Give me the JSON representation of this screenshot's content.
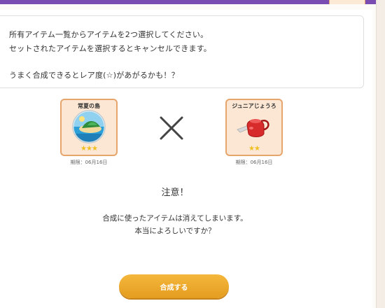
{
  "instructions": {
    "line1": "所有アイテム一覧からアイテムを2つ選択してください。",
    "line2": "セットされたアイテムを選択するとキャンセルできます。",
    "line3": "うまく合成できるとレア度(☆)があがるかも！？"
  },
  "items": [
    {
      "name": "常夏の島",
      "stars": "★★★",
      "rarity_stars": 3,
      "expiry": "期限：06月16日",
      "icon": "tropical-island-icon"
    },
    {
      "name": "ジュニアじょうろ",
      "stars": "★★",
      "rarity_stars": 2,
      "expiry": "期限：06月16日",
      "icon": "watering-can-icon"
    }
  ],
  "combine_symbol_icon": "times-icon",
  "notice": {
    "title": "注意！",
    "line1": "合成に使ったアイテムは消えてしまいます。",
    "line2": "本当によろしいですか？"
  },
  "buttons": {
    "synthesize_label": "合成する"
  },
  "colors": {
    "header_bar": "#7a4bb1",
    "card_border": "#e6a56c",
    "card_fill": "#fbe7d3",
    "star": "#f0c020",
    "button": "#e9a62a"
  }
}
